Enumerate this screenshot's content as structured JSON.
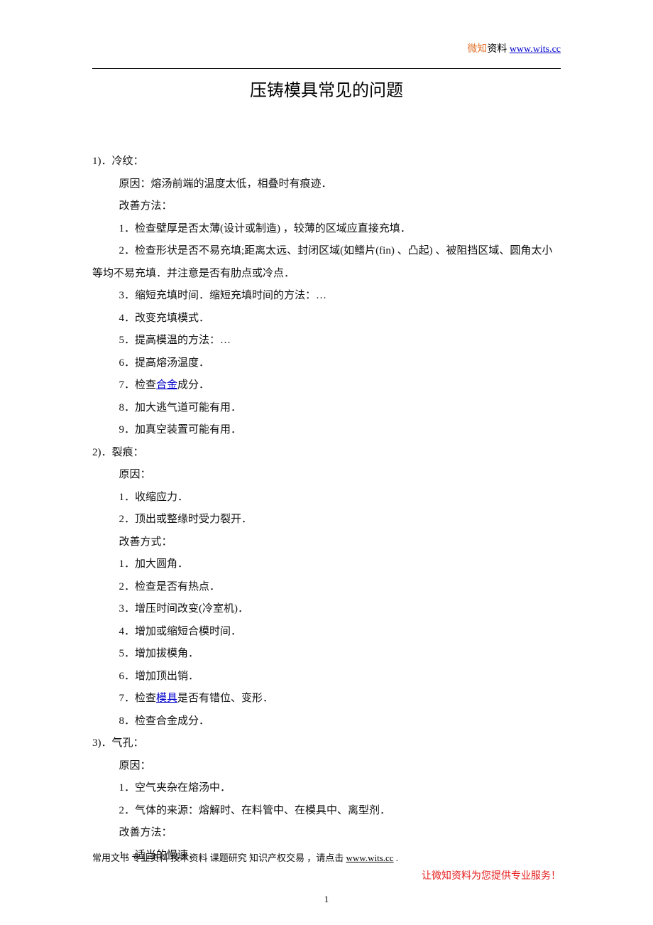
{
  "header": {
    "brand_left": "微知",
    "brand_right": "资料",
    "link": "www.wits.cc"
  },
  "title": "压铸模具常见的问题",
  "body": {
    "s1_head": "1)．冷纹：",
    "s1_cause": "原因：熔汤前端的温度太低，相叠时有痕迹．",
    "s1_fix_label": "改善方法：",
    "s1_1": "1．检查壁厚是否太薄(设计或制造) ，较薄的区域应直接充填．",
    "s1_2": "2．检查形状是否不易充填;距离太远、封闭区域(如鳍片(fin) 、凸起) 、被阻挡区域、圆角太小等均不易充填．并注意是否有肋点或冷点．",
    "s1_3": "3．缩短充填时间．缩短充填时间的方法：…",
    "s1_4": "4．改变充填模式．",
    "s1_5": "5．提高模温的方法：…",
    "s1_6": "6．提高熔汤温度．",
    "s1_7_pre": "7．检查",
    "s1_7_link": "合金",
    "s1_7_post": "成分．",
    "s1_8": "8．加大逃气道可能有用．",
    "s1_9": "9．加真空装置可能有用．",
    "s2_head": "2)．裂痕：",
    "s2_cause_label": "原因：",
    "s2_c1": "1．收缩应力．",
    "s2_c2": "2．顶出或整缘时受力裂开．",
    "s2_fix_label": "改善方式：",
    "s2_1": "1．加大圆角．",
    "s2_2": "2．检查是否有热点．",
    "s2_3": "3．增压时间改变(冷室机)．",
    "s2_4": "4．增加或缩短合模时间．",
    "s2_5": "5．增加拔模角．",
    "s2_6": "6．增加顶出销．",
    "s2_7_pre": "7．检查",
    "s2_7_link": "模具",
    "s2_7_post": "是否有错位、变形．",
    "s2_8": "8．检查合金成分．",
    "s3_head": "3)．气孔：",
    "s3_cause_label": "原因：",
    "s3_c1": "1．空气夹杂在熔汤中．",
    "s3_c2": "2．气体的来源：熔解时、在料管中、在模具中、离型剂．",
    "s3_fix_label": "改善方法：",
    "s3_1": "1．适当的慢速．"
  },
  "footer": {
    "line1_pre": "常用文书 专业资料 技术资料 课题研究 知识产权交易 ，请点击 ",
    "line1_link": "www.wits.cc",
    "line1_post": " .",
    "line2": "让微知资料为您提供专业服务！"
  },
  "page_number": "1"
}
